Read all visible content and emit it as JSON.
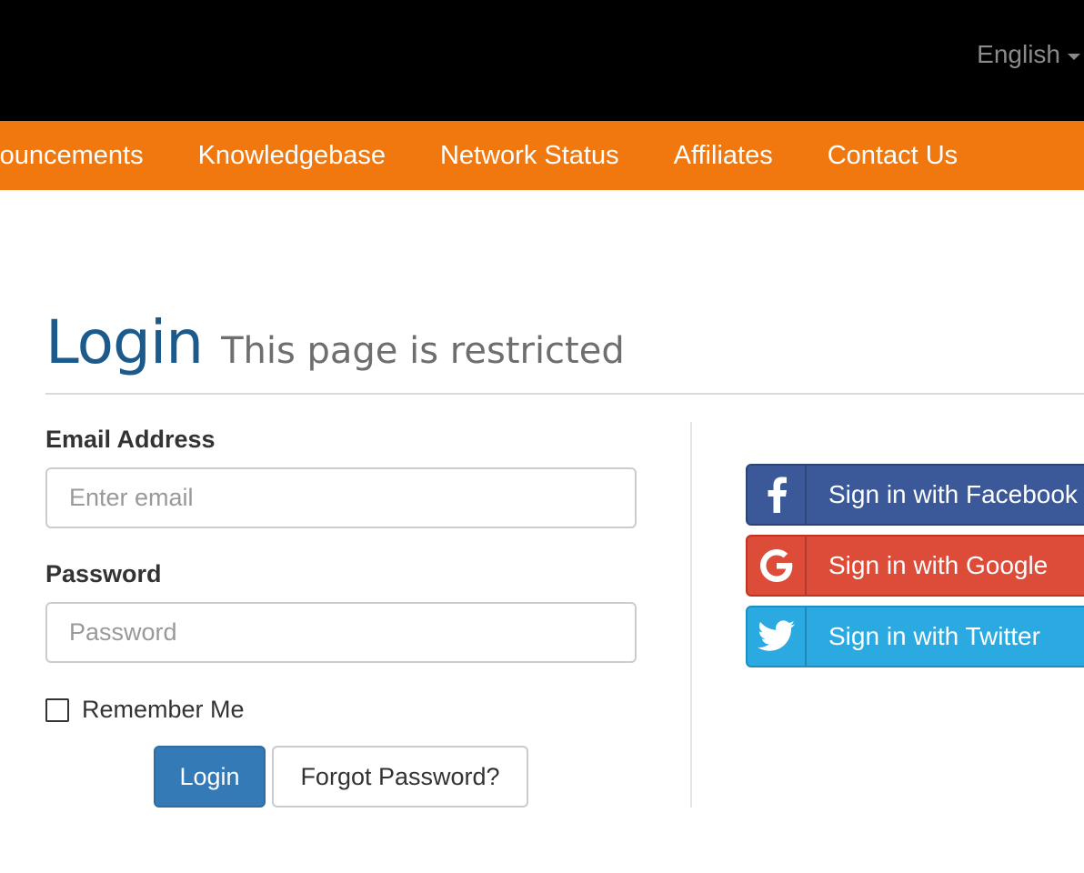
{
  "header": {
    "language": "English"
  },
  "nav": {
    "items": [
      {
        "label": "Announcements"
      },
      {
        "label": "Knowledgebase"
      },
      {
        "label": "Network Status"
      },
      {
        "label": "Affiliates"
      },
      {
        "label": "Contact Us"
      }
    ]
  },
  "page": {
    "title": "Login",
    "subtitle": "This page is restricted"
  },
  "form": {
    "email_label": "Email Address",
    "email_placeholder": "Enter email",
    "email_value": "",
    "password_label": "Password",
    "password_placeholder": "Password",
    "password_value": "",
    "remember_label": "Remember Me",
    "remember_checked": false,
    "login_button": "Login",
    "forgot_button": "Forgot Password?"
  },
  "social": {
    "facebook": {
      "label": "Sign in with Facebook",
      "icon": "facebook-icon",
      "color": "#3b5998"
    },
    "google": {
      "label": "Sign in with Google",
      "icon": "google-icon",
      "color": "#dd4b39"
    },
    "twitter": {
      "label": "Sign in with Twitter",
      "icon": "twitter-icon",
      "color": "#2ba9e1"
    }
  },
  "colors": {
    "topbar": "#000000",
    "navbar": "#f0780f",
    "title": "#1c5a8c",
    "primary": "#337ab7"
  }
}
